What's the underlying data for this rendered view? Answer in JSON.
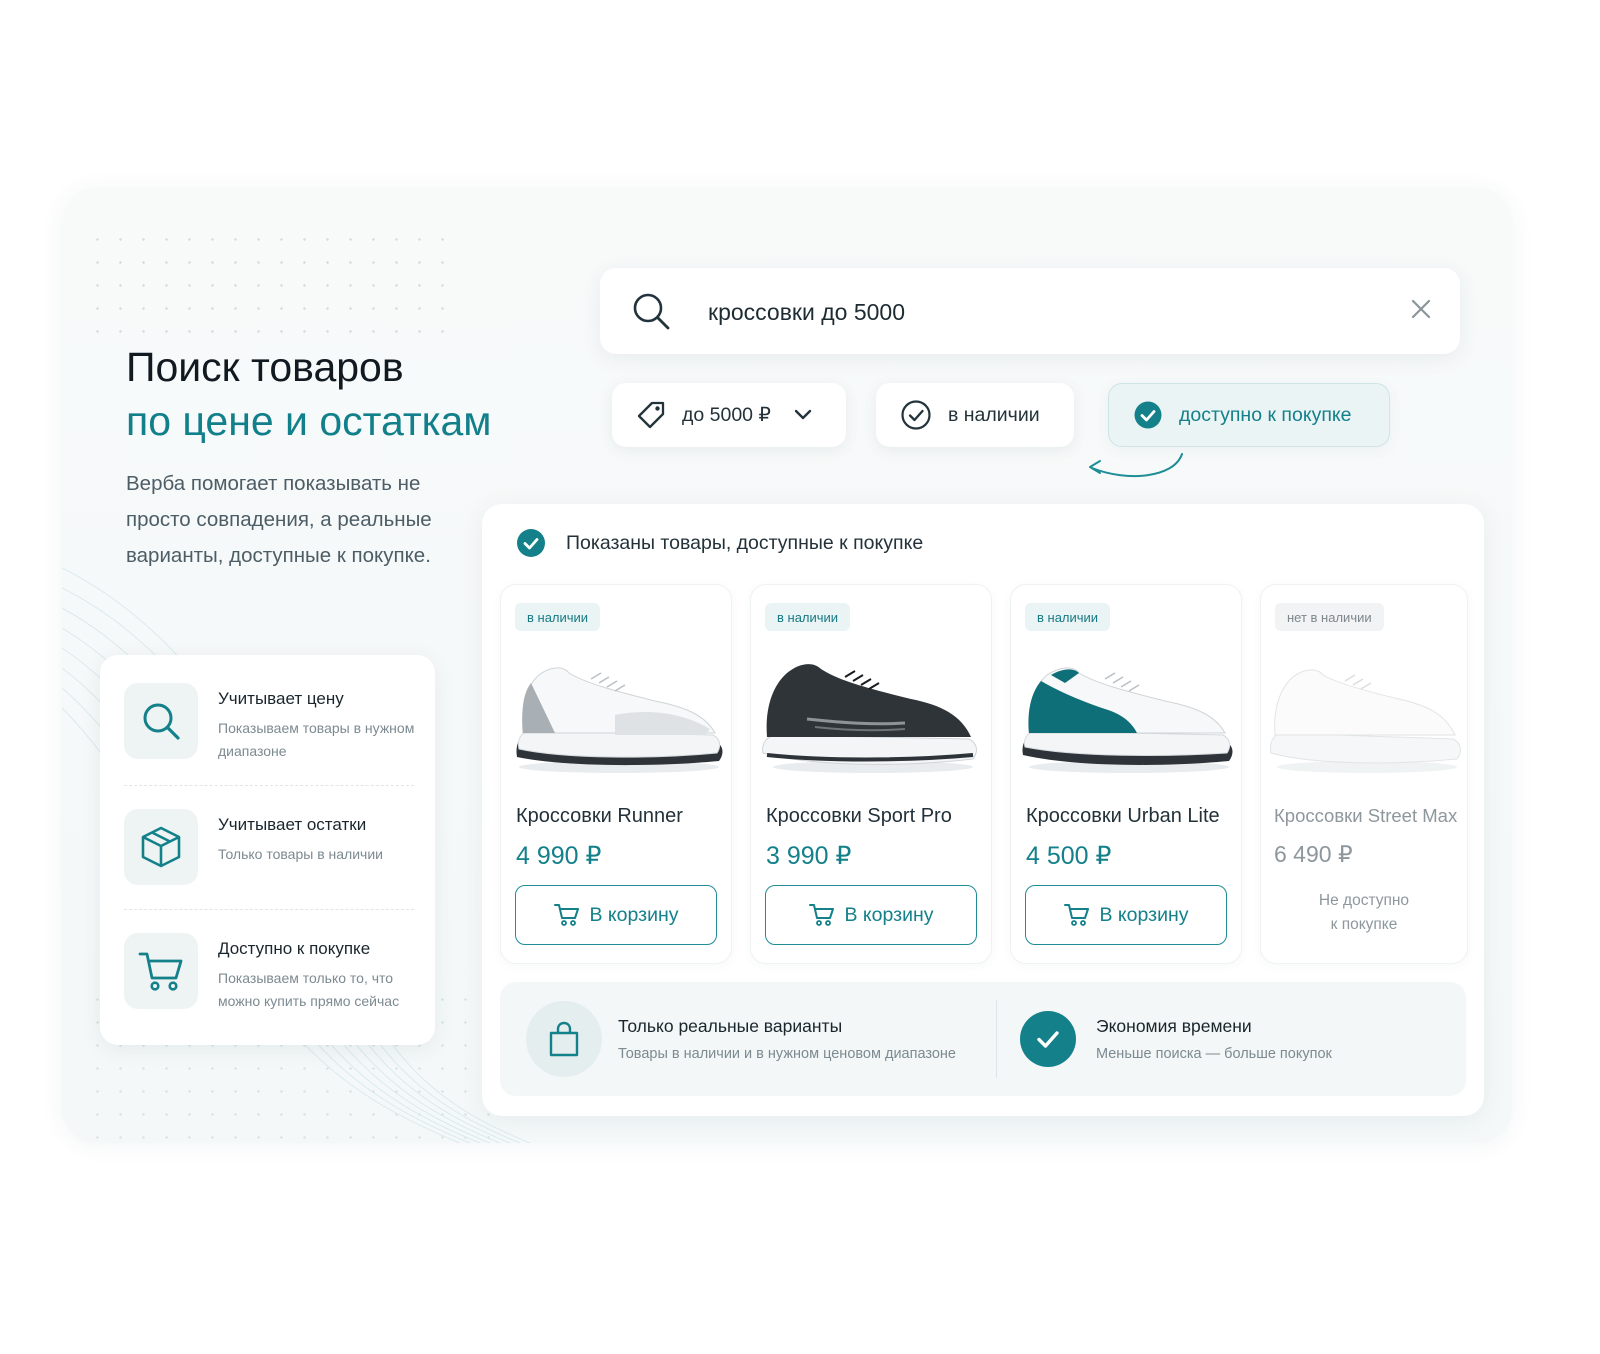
{
  "headline": {
    "line1": "Поиск товаров",
    "line2": "по цене и остаткам"
  },
  "lead": "Верба помогает показывать не просто совпадения, а реальные варианты, доступные к покупке.",
  "features": [
    {
      "icon": "search-icon",
      "title": "Учитывает цену",
      "desc": "Показываем товары в нужном диапазоне"
    },
    {
      "icon": "box-icon",
      "title": "Учитывает остатки",
      "desc": "Только товары в наличии"
    },
    {
      "icon": "cart-icon",
      "title": "Доступно к покупке",
      "desc": "Показываем только то, что можно купить прямо сейчас"
    }
  ],
  "search": {
    "value": "кроссовки до 5000",
    "icon": "search-icon",
    "clear_icon": "close-icon"
  },
  "filters": [
    {
      "label": "до 5000 ₽",
      "icon": "price-tag-icon",
      "dropdown": true,
      "active": false
    },
    {
      "label": "в наличии",
      "icon": "check-circle-icon",
      "active": false
    },
    {
      "label": "доступно к покупке",
      "icon": "check-filled-icon",
      "active": true
    }
  ],
  "results": {
    "header": "Показаны товары, доступные к покупке",
    "products": [
      {
        "badge": "в наличии",
        "name": "Кроссовки Runner",
        "price": "4 990 ₽",
        "button": "В корзину",
        "available": true,
        "shoe_color": "grey"
      },
      {
        "badge": "в наличии",
        "name": "Кроссовки Sport Pro",
        "price": "3 990 ₽",
        "button": "В корзину",
        "available": true,
        "shoe_color": "black"
      },
      {
        "badge": "в наличии",
        "name": "Кроссовки Urban Lite",
        "price": "4 500 ₽",
        "button": "В корзину",
        "available": true,
        "shoe_color": "teal"
      },
      {
        "badge": "нет в наличии",
        "name": "Кроссовки Street Max",
        "price": "6 490 ₽",
        "unavailable_note_1": "Не доступно",
        "unavailable_note_2": "к покупке",
        "available": false,
        "shoe_color": "white"
      }
    ]
  },
  "benefits": [
    {
      "icon": "bag-icon",
      "title": "Только реальные варианты",
      "desc": "Товары в наличии и в нужном ценовом диапазоне"
    },
    {
      "icon": "check-filled-icon",
      "title": "Экономия времени",
      "desc": "Меньше поиска — больше покупок"
    }
  ],
  "colors": {
    "accent": "#13808a",
    "accent_bg": "#eaf4f4",
    "text": "#1d2b33",
    "muted": "#7c8a91"
  }
}
